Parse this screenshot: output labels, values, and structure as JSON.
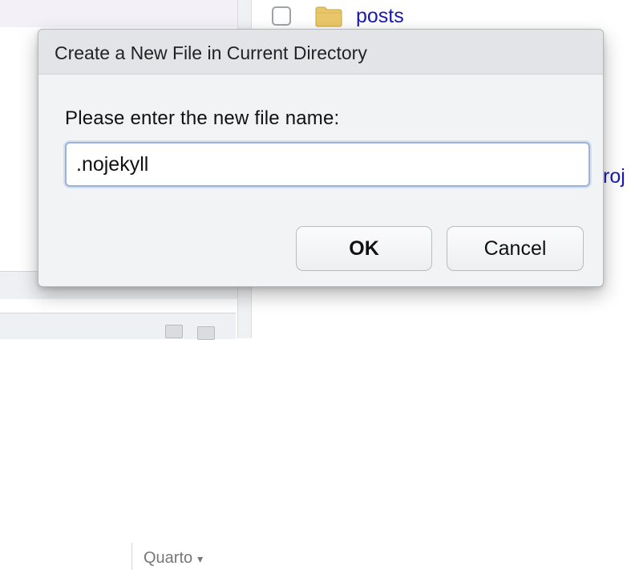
{
  "background": {
    "left_bar_select": "Quarto",
    "files": [
      {
        "name": "posts",
        "icon": "folder-icon"
      }
    ],
    "truncated_text": "roj"
  },
  "dialog": {
    "title": "Create a New File in Current Directory",
    "prompt": "Please enter the new file name:",
    "input_value": ".nojekyll",
    "ok_label": "OK",
    "cancel_label": "Cancel"
  },
  "colors": {
    "link": "#1a1ab0",
    "dialog_bg": "#f2f3f5",
    "titlebar_bg": "#e3e4e8",
    "input_focus_border": "#9bb3d8",
    "folder": "#e9c768"
  }
}
